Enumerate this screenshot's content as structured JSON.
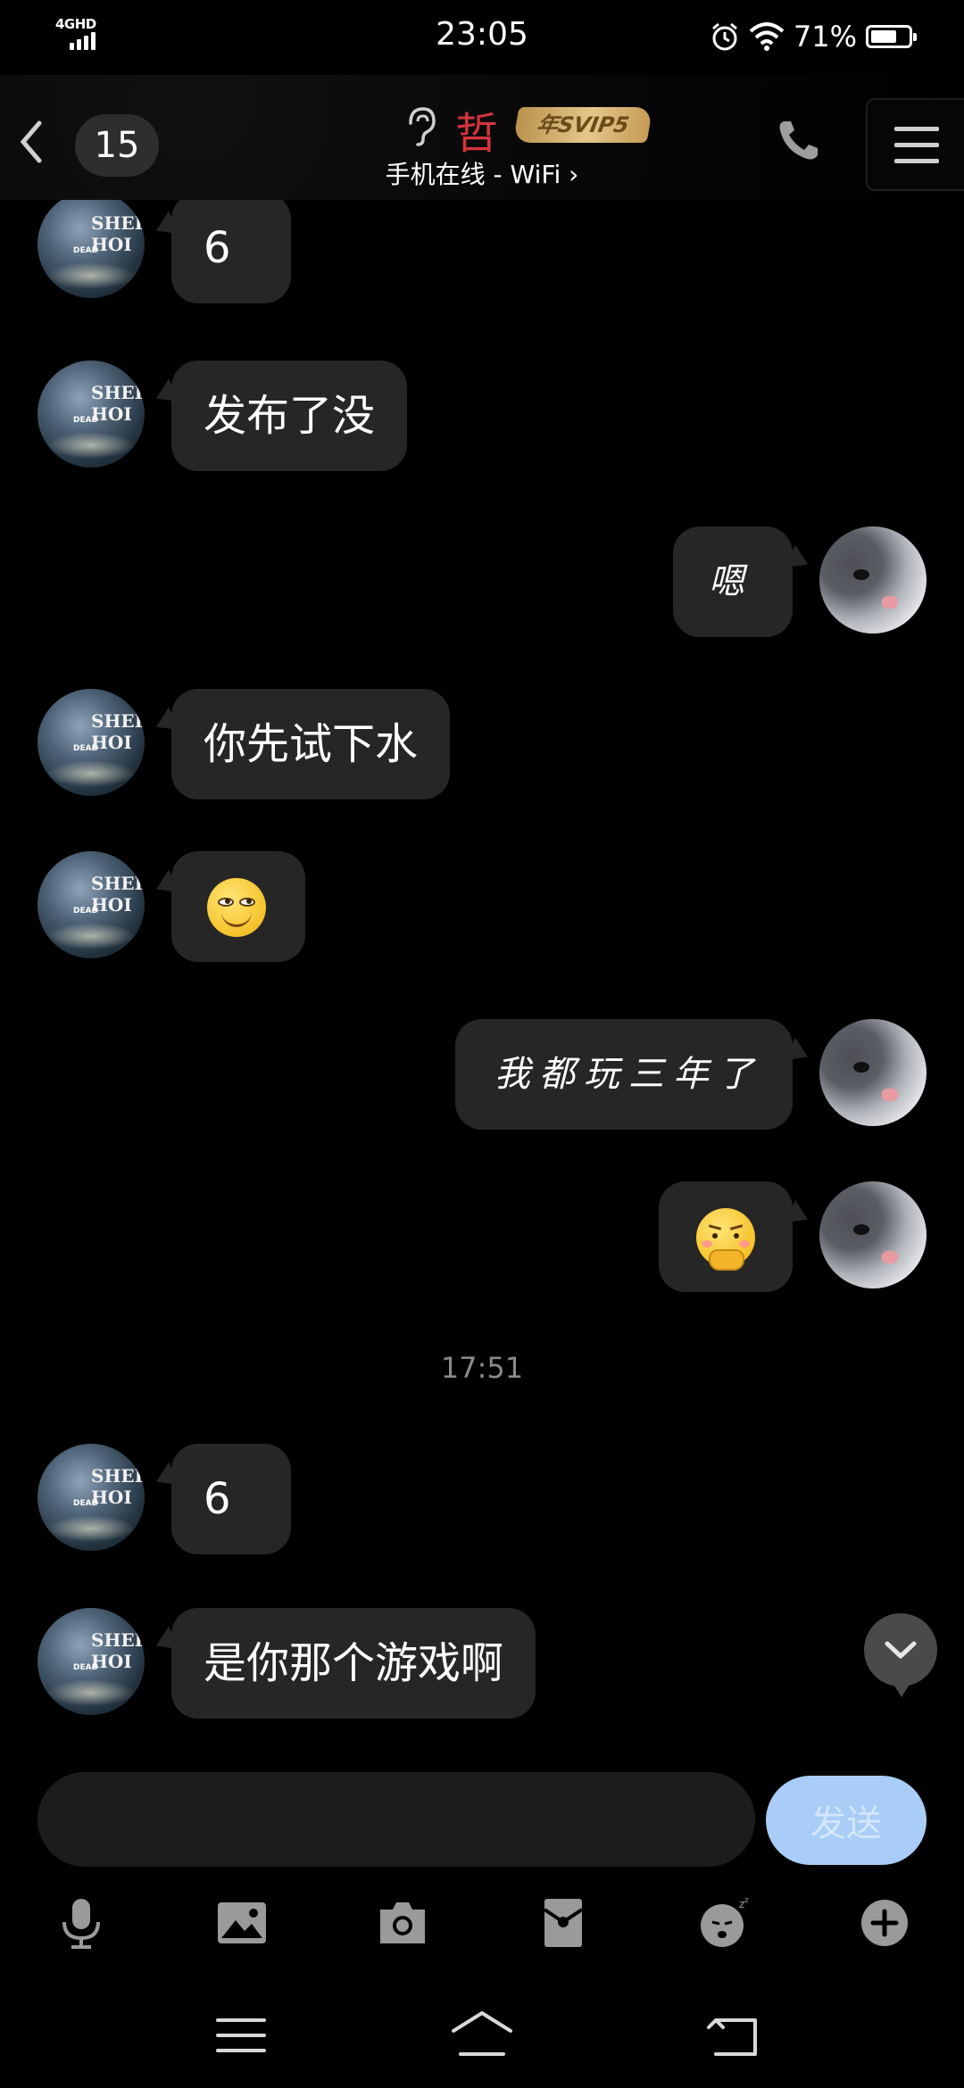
{
  "status_bar": {
    "network": "4GHD",
    "time": "23:05",
    "battery_pct": "71%",
    "battery_level": 0.71,
    "icons": [
      "signal-icon",
      "alarm-icon",
      "wifi-icon",
      "battery-icon"
    ]
  },
  "header": {
    "unread_count": "15",
    "contact_name": "哲",
    "vip_badge": "年SVIP5",
    "online_status": "手机在线 - WiFi ›",
    "icons": [
      "back-icon",
      "ear-icon",
      "phone-icon",
      "menu-icon"
    ]
  },
  "messages": [
    {
      "side": "left",
      "text": "6"
    },
    {
      "side": "left",
      "text": "发布了没"
    },
    {
      "side": "right",
      "text": "嗯"
    },
    {
      "side": "left",
      "text": "你先试下水"
    },
    {
      "side": "left",
      "emoji": "smirk-emoji"
    },
    {
      "side": "right",
      "text": "我都玩三年了"
    },
    {
      "side": "right",
      "emoji": "thinking-emoji"
    },
    {
      "side": "left",
      "text": "6"
    },
    {
      "side": "left",
      "text": "是你那个游戏啊"
    }
  ],
  "timestamp": "17:51",
  "avatars": {
    "left_text": "SHER HOI",
    "left_small": "DEAD"
  },
  "composer": {
    "input_value": "",
    "send_label": "发送"
  },
  "toolbar_icons": [
    "microphone-icon",
    "image-icon",
    "camera-icon",
    "red-packet-icon",
    "sticker-icon",
    "plus-icon"
  ],
  "nav_icons": [
    "menu-nav-icon",
    "home-nav-icon",
    "back-nav-icon"
  ],
  "colors": {
    "background": "#000000",
    "bubble": "#262626",
    "name": "#d5343d",
    "send_button": "#a9cdf6",
    "vip_gold": "#d9b36e"
  }
}
